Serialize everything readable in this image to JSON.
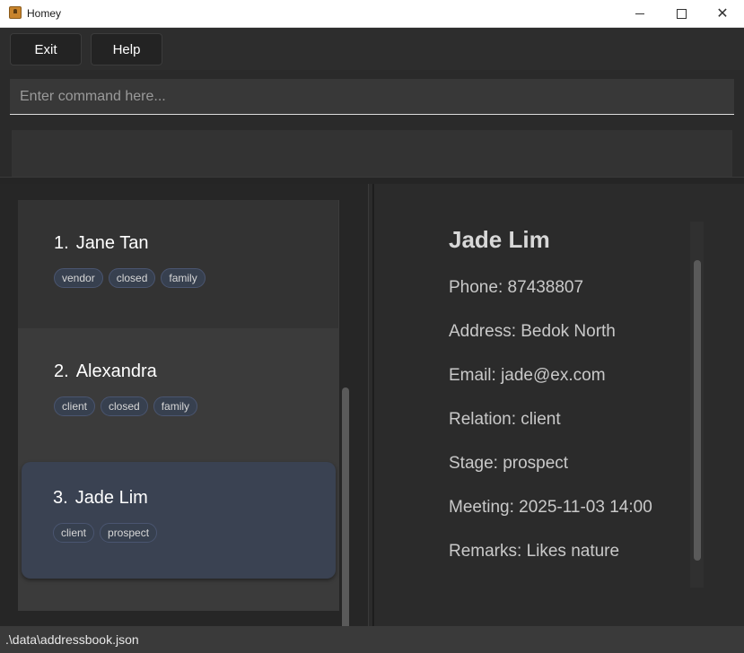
{
  "window": {
    "title": "Homey",
    "min_icon": "minimize-icon",
    "max_icon": "maximize-icon",
    "close_icon": "close-icon",
    "close_glyph": "✕"
  },
  "menu": {
    "exit_label": "Exit",
    "help_label": "Help"
  },
  "command": {
    "placeholder": "Enter command here..."
  },
  "result": {
    "text": ""
  },
  "persons": [
    {
      "index": "1.",
      "name": "Jane Tan",
      "tags": [
        "vendor",
        "closed",
        "family"
      ]
    },
    {
      "index": "2.",
      "name": "Alexandra",
      "tags": [
        "client",
        "closed",
        "family"
      ]
    },
    {
      "index": "3.",
      "name": "Jade Lim",
      "tags": [
        "client",
        "prospect"
      ]
    }
  ],
  "selected_index": 2,
  "detail": {
    "name": "Jade Lim",
    "phone": "Phone: 87438807",
    "address": "Address: Bedok North",
    "email": "Email: jade@ex.com",
    "relation": "Relation: client",
    "stage": "Stage: prospect",
    "meeting": "Meeting: 2025-11-03 14:00",
    "remarks": "Remarks: Likes nature"
  },
  "status": {
    "file_path": ".\\data\\addressbook.json"
  },
  "colors": {
    "background": "#2b2b2b",
    "selected_card": "#3a4252",
    "tag_bg": "#37404f",
    "text": "#ffffff"
  }
}
